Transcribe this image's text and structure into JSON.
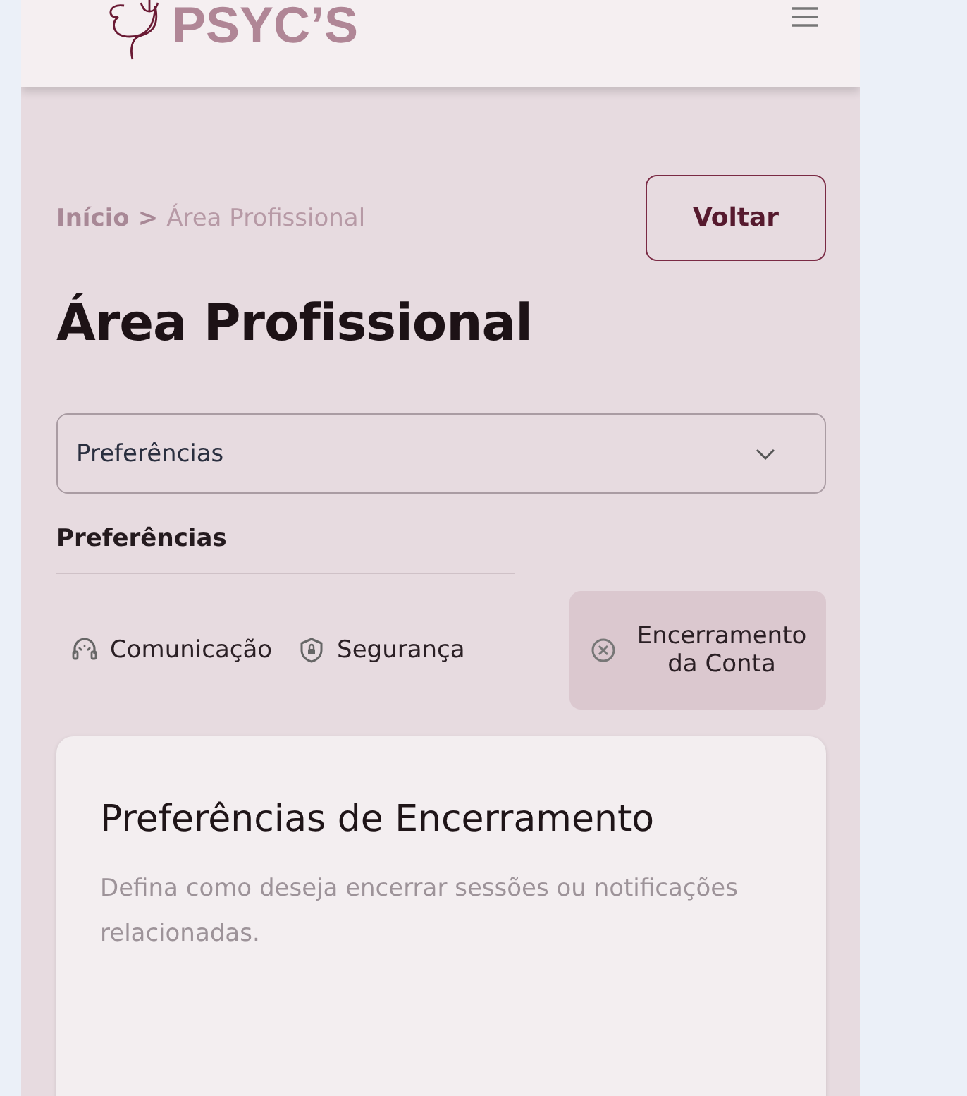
{
  "header": {
    "logo": "PSYC’S"
  },
  "breadcrumb": {
    "home": "Início",
    "separator": ">",
    "current": "Área Profissional"
  },
  "back_button": "Voltar",
  "title": "Área Profissional",
  "section_select": {
    "value": "Preferências"
  },
  "section_label": "Preferências",
  "tabs": [
    {
      "label": "Comunicação",
      "kind": "headset",
      "selected": false
    },
    {
      "label": "Segurança",
      "kind": "shield",
      "selected": false
    },
    {
      "label": "Encerramento da Conta",
      "kind": "close",
      "selected": true
    }
  ],
  "card": {
    "title": "Preferências de Encerramento",
    "description": "Defina como deseja encerrar sessões ou notificações relacionadas."
  }
}
